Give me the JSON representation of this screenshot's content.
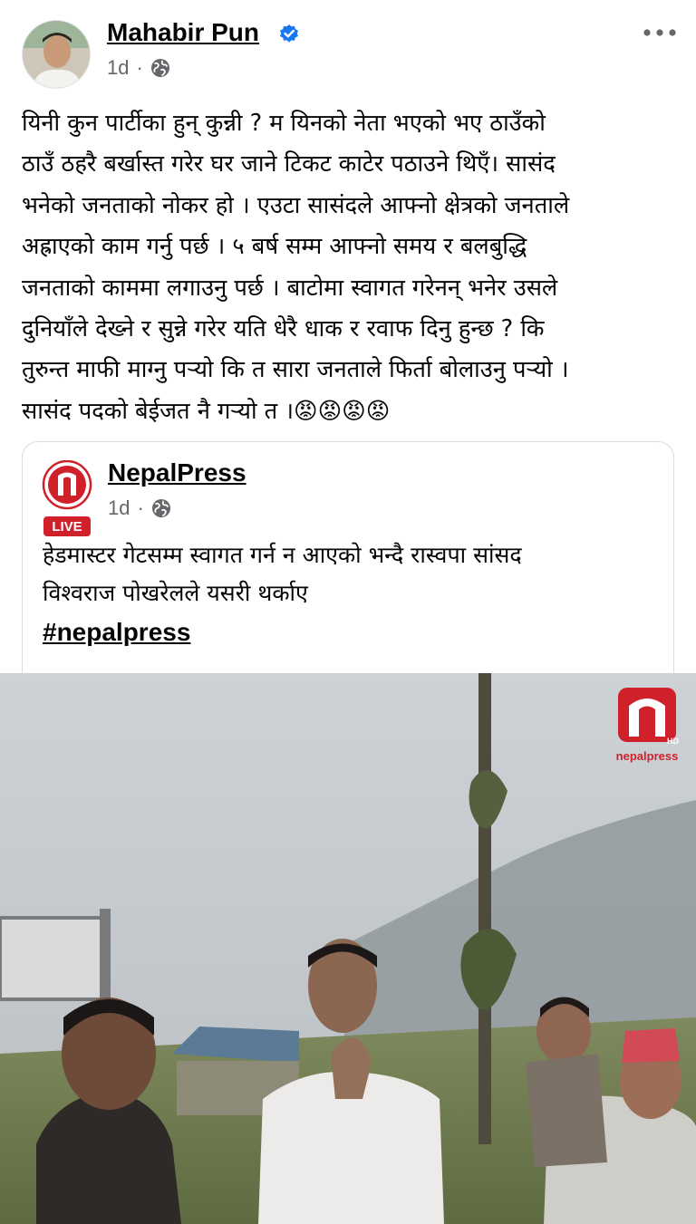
{
  "post": {
    "author": "Mahabir Pun",
    "time": "1d",
    "dot": "·",
    "text": "यिनी कुन पार्टीका हुन् कुन्नी ? म यिनको नेता भएको भए  ठाउँको\nठाउँ ठहरै बर्खास्त गरेर घर जाने टिकट काटेर पठाउने थिएँ। सासंद\nभनेको जनताको नोकर हो । एउटा सासंदले आफ्नो क्षेत्रको जनताले\nअह्राएको काम गर्नु पर्छ । ५ बर्ष सम्म आफ्नो समय र बलबुद्धि\nजनताको काममा लगाउनु पर्छ । बाटोमा स्वागत गरेनन् भनेर उसले\nदुनियाँले देख्ने र सुन्ने गरेर यति धेरै धाक र रवाफ दिनु हुन्छ ? कि\nतुरुन्त माफी माग्नु पऱ्यो कि त सारा जनताले फिर्ता बोलाउनु पऱ्यो ।\nसासंद पदको बेईजत नै गऱ्यो त ।",
    "emojis": "😡😡😡😡"
  },
  "shared": {
    "page_name": "NepalPress",
    "time": "1d",
    "dot": "·",
    "live_badge": "LIVE",
    "text": "हेडमास्टर गेटसम्म स्वागत गर्न न आएको भन्दै रास्वपा सांसद\nविश्वराज पोखरेलले यसरी थर्काए",
    "hashtag": "#nepalpress"
  },
  "video": {
    "watermark_label": "nepalpress",
    "watermark_hd": "HD"
  },
  "colors": {
    "verified_blue": "#1877f2",
    "brand_red": "#d0202a",
    "meta_gray": "#65676b"
  },
  "icons": [
    "verified-badge-icon",
    "globe-icon",
    "more-options-icon",
    "nepalpress-logo-icon"
  ]
}
